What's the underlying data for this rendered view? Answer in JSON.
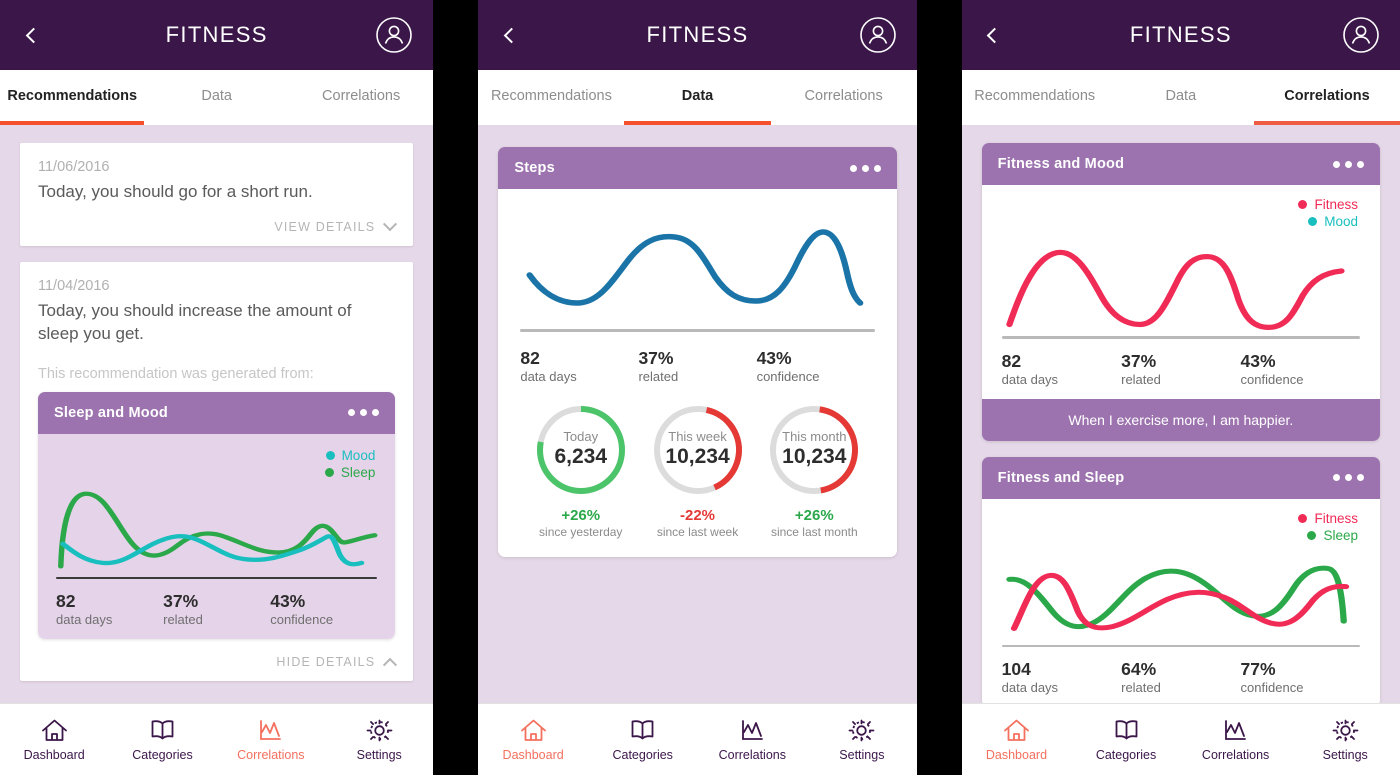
{
  "app": {
    "title": "FITNESS",
    "back_icon": "chevron-left-icon",
    "avatar_icon": "user-avatar-icon",
    "header_color": "#3B1649",
    "card_header_color": "#9C73AE",
    "background_color": "#E5D8E8",
    "accent_color": "#F4512C"
  },
  "tabs": [
    {
      "label": "Recommendations"
    },
    {
      "label": "Data"
    },
    {
      "label": "Correlations"
    }
  ],
  "bottom_nav": [
    {
      "label": "Dashboard",
      "icon": "home-icon"
    },
    {
      "label": "Categories",
      "icon": "book-icon"
    },
    {
      "label": "Correlations",
      "icon": "line-chart-icon"
    },
    {
      "label": "Settings",
      "icon": "gear-icon"
    }
  ],
  "panel1": {
    "active_tab": "Recommendations",
    "active_nav": "Correlations",
    "recommendations": [
      {
        "date": "11/06/2016",
        "text": "Today, you should go for a short run.",
        "action": "VIEW DETAILS",
        "action_icon": "chevron-down-icon",
        "expanded": false
      },
      {
        "date": "11/04/2016",
        "text": "Today, you should increase the amount of sleep you get.",
        "generated_from_label": "This recommendation was generated from:",
        "action": "HIDE DETAILS",
        "action_icon": "chevron-up-icon",
        "expanded": true,
        "card": {
          "title": "Sleep and Mood",
          "menu_icon": "overflow-menu-icon",
          "legend": [
            {
              "label": "Mood",
              "color": "#19BFBF"
            },
            {
              "label": "Sleep",
              "color": "#2BA84A"
            }
          ],
          "stats": [
            {
              "value": "82",
              "label": "data days"
            },
            {
              "value": "37%",
              "label": "related"
            },
            {
              "value": "43%",
              "label": "confidence"
            }
          ]
        }
      }
    ]
  },
  "panel2": {
    "active_tab": "Data",
    "active_nav": "Dashboard",
    "card": {
      "title": "Steps",
      "menu_icon": "overflow-menu-icon",
      "line_color": "#1A74A8",
      "stats": [
        {
          "value": "82",
          "label": "data days"
        },
        {
          "value": "37%",
          "label": "related"
        },
        {
          "value": "43%",
          "label": "confidence"
        }
      ],
      "gauges": [
        {
          "period": "Today",
          "value": "6,234",
          "percent": 78,
          "ring_color": "#4CC46A",
          "delta": "+26%",
          "delta_color": "#2BA84A",
          "delta_label": "since yesterday"
        },
        {
          "period": "This week",
          "value": "10,234",
          "percent": 40,
          "ring_color": "#E53935",
          "delta": "-22%",
          "delta_color": "#E53935",
          "delta_label": "since last week"
        },
        {
          "period": "This month",
          "value": "10,234",
          "percent": 45,
          "ring_color": "#E53935",
          "delta": "+26%",
          "delta_color": "#2BA84A",
          "delta_label": "since last month"
        }
      ]
    }
  },
  "panel3": {
    "active_tab": "Correlations",
    "active_nav": "Dashboard",
    "cards": [
      {
        "title": "Fitness and Mood",
        "menu_icon": "overflow-menu-icon",
        "legend": [
          {
            "label": "Fitness",
            "color": "#F02B56"
          },
          {
            "label": "Mood",
            "color": "#19BFBF"
          }
        ],
        "stats": [
          {
            "value": "82",
            "label": "data days"
          },
          {
            "value": "37%",
            "label": "related"
          },
          {
            "value": "43%",
            "label": "confidence"
          }
        ],
        "insight": "When I exercise more, I am happier."
      },
      {
        "title": "Fitness and Sleep",
        "menu_icon": "overflow-menu-icon",
        "legend": [
          {
            "label": "Fitness",
            "color": "#F02B56"
          },
          {
            "label": "Sleep",
            "color": "#2BA84A"
          }
        ],
        "stats": [
          {
            "value": "104",
            "label": "data days"
          },
          {
            "value": "64%",
            "label": "related"
          },
          {
            "value": "77%",
            "label": "confidence"
          }
        ]
      }
    ]
  },
  "chart_data": [
    {
      "type": "line",
      "title": "Sleep and Mood",
      "xlabel": "",
      "ylabel": "",
      "grid": false,
      "legend_position": "top-right",
      "series": [
        {
          "name": "Mood",
          "color": "#19BFBF",
          "values": [
            18,
            10,
            6,
            10,
            26,
            44,
            32,
            18,
            30,
            44,
            34,
            18,
            10,
            12,
            32,
            52,
            30,
            6
          ]
        },
        {
          "name": "Sleep",
          "color": "#2BA84A",
          "values": [
            2,
            46,
            72,
            76,
            58,
            34,
            22,
            30,
            40,
            28,
            36,
            46,
            48,
            44,
            26,
            34,
            48,
            52
          ]
        }
      ]
    },
    {
      "type": "line",
      "title": "Steps",
      "xlabel": "",
      "ylabel": "",
      "grid": false,
      "legend_position": "none",
      "series": [
        {
          "name": "Steps",
          "color": "#1A74A8",
          "values": [
            40,
            26,
            16,
            14,
            22,
            48,
            70,
            76,
            66,
            44,
            26,
            20,
            20,
            26,
            50,
            78,
            60,
            18
          ]
        }
      ]
    },
    {
      "type": "line",
      "title": "Fitness and Mood",
      "xlabel": "",
      "ylabel": "",
      "grid": false,
      "legend_position": "top-right",
      "series": [
        {
          "name": "Fitness",
          "color": "#F02B56",
          "values": [
            2,
            30,
            66,
            84,
            74,
            40,
            14,
            10,
            26,
            62,
            70,
            62,
            30,
            8,
            6,
            22,
            44,
            52
          ]
        },
        {
          "name": "Mood",
          "color": "#19BFBF",
          "values": []
        }
      ]
    },
    {
      "type": "line",
      "title": "Fitness and Sleep",
      "xlabel": "",
      "ylabel": "",
      "grid": false,
      "legend_position": "top-right",
      "series": [
        {
          "name": "Fitness",
          "color": "#F02B56",
          "values": [
            6,
            30,
            56,
            44,
            22,
            14,
            16,
            26,
            40,
            48,
            44,
            32,
            20,
            12,
            16,
            30,
            46,
            54
          ]
        },
        {
          "name": "Sleep",
          "color": "#2BA84A",
          "values": [
            50,
            46,
            30,
            18,
            34,
            52,
            56,
            48,
            32,
            20,
            22,
            34,
            46,
            54,
            50,
            34,
            16,
            8
          ]
        }
      ]
    }
  ]
}
